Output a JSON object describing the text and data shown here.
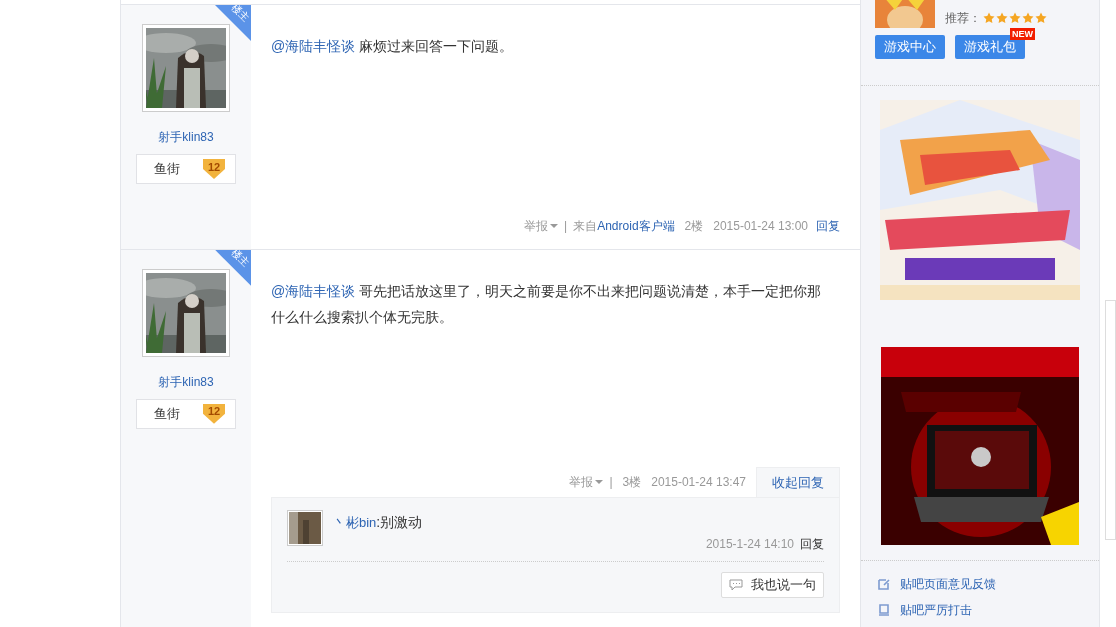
{
  "posts": [
    {
      "author": "射手klin83",
      "badge": "楼主",
      "level_name": "鱼街",
      "level_badge": "12",
      "mention": "@海陆丰怪谈",
      "text": " 麻烦过来回答一下问题。",
      "footer": {
        "report": "举报",
        "separator": "|",
        "source_prefix": "来自",
        "source": "Android客户端",
        "floor": "2楼",
        "time": "2015-01-24 13:00",
        "reply": "回复"
      }
    },
    {
      "author": "射手klin83",
      "badge": "楼主",
      "level_name": "鱼街",
      "level_badge": "12",
      "mention": "@海陆丰怪谈",
      "text": " 哥先把话放这里了，明天之前要是你不出来把问题说清楚，本手一定把你那什么什么搜索扒个体无完肤。",
      "footer": {
        "report": "举报",
        "separator": "|",
        "floor": "3楼",
        "time": "2015-01-24 13:47",
        "toggle": "收起回复"
      },
      "replies": [
        {
          "user": "丶彬bin",
          "colon": ":",
          "text": "别激动",
          "time": "2015-1-24 14:10",
          "reply": "回复"
        }
      ],
      "say_button": "我也说一句"
    }
  ],
  "sidebar": {
    "recommend_label": "推荐：",
    "stars": 5,
    "buttons": [
      {
        "label": "游戏中心"
      },
      {
        "label": "游戏礼包",
        "badge": "NEW"
      }
    ],
    "ads": [
      {
        "kind": "picture"
      },
      {
        "kind": "picture"
      }
    ],
    "links": [
      {
        "label": "贴吧页面意见反馈"
      },
      {
        "label": "贴吧严厉打击"
      }
    ]
  }
}
